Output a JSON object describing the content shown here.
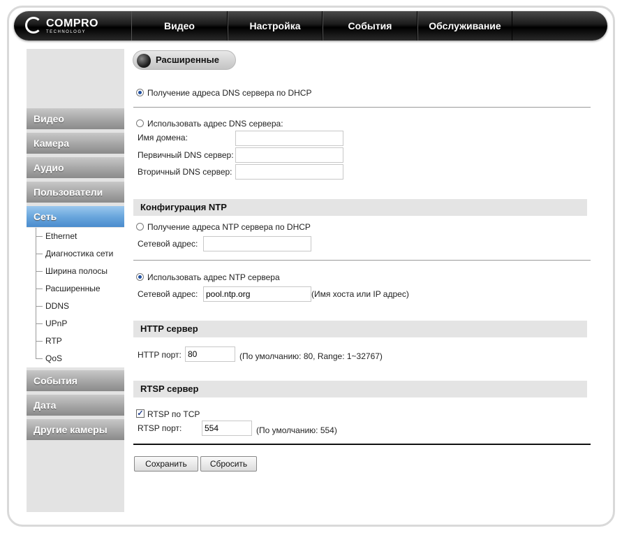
{
  "logo": {
    "brand": "COMPRO",
    "sub": "TECHNOLOGY"
  },
  "nav": {
    "tabs": [
      {
        "label": "Видео"
      },
      {
        "label": "Настройка"
      },
      {
        "label": "События"
      },
      {
        "label": "Обслуживание"
      }
    ]
  },
  "sidebar": {
    "items": [
      {
        "label": "Видео"
      },
      {
        "label": "Камера"
      },
      {
        "label": "Аудио"
      },
      {
        "label": "Пользователи"
      },
      {
        "label": "Сеть"
      },
      {
        "label": "События"
      },
      {
        "label": "Дата"
      },
      {
        "label": "Другие камеры"
      }
    ],
    "network_subitems": [
      {
        "label": "Ethernet"
      },
      {
        "label": "Диагностика сети"
      },
      {
        "label": "Ширина полосы"
      },
      {
        "label": "Расширенные"
      },
      {
        "label": "DDNS"
      },
      {
        "label": "UPnP"
      },
      {
        "label": "RTP"
      },
      {
        "label": "QoS"
      }
    ]
  },
  "page": {
    "title": "Расширенные"
  },
  "dns": {
    "dhcp_label": "Получение адреса DNS сервера по DHCP",
    "manual_label": "Использовать адрес DNS сервера:",
    "domain_label": "Имя домена:",
    "primary_label": "Первичный DNS сервер:",
    "secondary_label": "Вторичный DNS сервер:",
    "domain_value": "",
    "primary_value": "",
    "secondary_value": ""
  },
  "ntp": {
    "header": "Конфигурация NTP",
    "dhcp_label": "Получение адреса NTP сервера по DHCP",
    "address_label": "Сетевой адрес:",
    "dhcp_address_value": "",
    "manual_label": "Использовать адрес NTP сервера",
    "manual_address_label": "Сетевой адрес:",
    "manual_address_value": "pool.ntp.org",
    "hint": "(Имя хоста или IP адрес)"
  },
  "http": {
    "header": "HTTP сервер",
    "port_label": "HTTP порт:",
    "port_value": "80",
    "hint": "(По умолчанию: 80, Range: 1~32767)"
  },
  "rtsp": {
    "header": "RTSP сервер",
    "tcp_label": "RTSP по TCP",
    "port_label": "RTSP порт:",
    "port_value": "554",
    "hint": "(По умолчанию: 554)"
  },
  "actions": {
    "save": "Сохранить",
    "reset": "Сбросить"
  }
}
